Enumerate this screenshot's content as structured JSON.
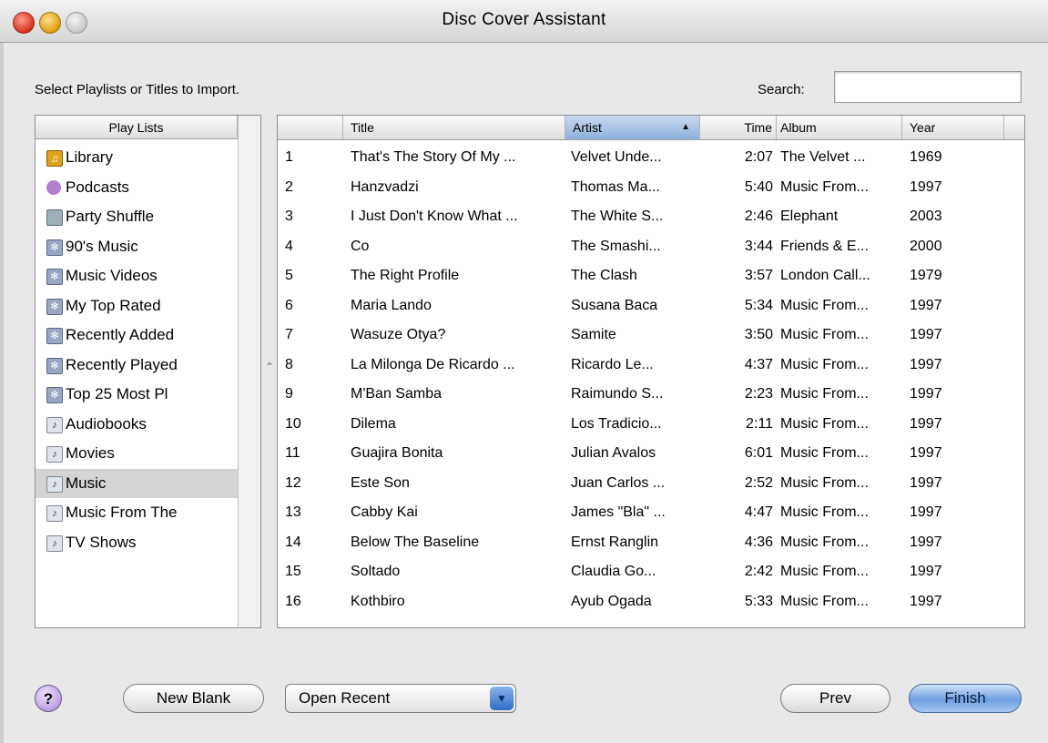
{
  "window": {
    "title": "Disc Cover Assistant"
  },
  "header": {
    "prompt": "Select Playlists or Titles to Import.",
    "search_label": "Search:",
    "search_value": ""
  },
  "playlists": {
    "header": "Play Lists",
    "items": [
      {
        "label": "Library",
        "icon": "library-icon",
        "selected": false
      },
      {
        "label": "Podcasts",
        "icon": "podcast-icon",
        "selected": false
      },
      {
        "label": "Party Shuffle",
        "icon": "party-shuffle-icon",
        "selected": false
      },
      {
        "label": "90's Music",
        "icon": "smart-playlist-icon",
        "selected": false
      },
      {
        "label": "Music Videos",
        "icon": "smart-playlist-icon",
        "selected": false
      },
      {
        "label": "My Top Rated",
        "icon": "smart-playlist-icon",
        "selected": false
      },
      {
        "label": "Recently Added",
        "icon": "smart-playlist-icon",
        "selected": false
      },
      {
        "label": "Recently Played",
        "icon": "smart-playlist-icon",
        "selected": false
      },
      {
        "label": "Top 25 Most Pl",
        "icon": "smart-playlist-icon",
        "selected": false
      },
      {
        "label": "Audiobooks",
        "icon": "playlist-icon",
        "selected": false
      },
      {
        "label": "Movies",
        "icon": "playlist-icon",
        "selected": false
      },
      {
        "label": "Music",
        "icon": "playlist-icon",
        "selected": true
      },
      {
        "label": "Music From The",
        "icon": "playlist-icon",
        "selected": false
      },
      {
        "label": "TV Shows",
        "icon": "playlist-icon",
        "selected": false
      }
    ]
  },
  "tracks": {
    "columns": {
      "title": "Title",
      "artist": "Artist",
      "time": "Time",
      "album": "Album",
      "year": "Year"
    },
    "sorted_by": "Artist",
    "sort_arrow": "▲",
    "rows": [
      {
        "num": "1",
        "title": "That's The Story Of My ...",
        "artist": "Velvet Unde...",
        "time": "2:07",
        "album": "The Velvet ...",
        "year": "1969"
      },
      {
        "num": "2",
        "title": "Hanzvadzi",
        "artist": "Thomas Ma...",
        "time": "5:40",
        "album": "Music From...",
        "year": "1997"
      },
      {
        "num": "3",
        "title": "I Just Don't Know What ...",
        "artist": "The White S...",
        "time": "2:46",
        "album": "Elephant",
        "year": "2003"
      },
      {
        "num": "4",
        "title": "Co",
        "artist": "The Smashi...",
        "time": "3:44",
        "album": "Friends & E...",
        "year": "2000"
      },
      {
        "num": "5",
        "title": "The Right Profile",
        "artist": "The Clash",
        "time": "3:57",
        "album": "London Call...",
        "year": "1979"
      },
      {
        "num": "6",
        "title": "Maria Lando",
        "artist": "Susana Baca",
        "time": "5:34",
        "album": "Music From...",
        "year": "1997"
      },
      {
        "num": "7",
        "title": "Wasuze Otya?",
        "artist": "Samite",
        "time": "3:50",
        "album": "Music From...",
        "year": "1997"
      },
      {
        "num": "8",
        "title": "La Milonga De Ricardo ...",
        "artist": "Ricardo Le...",
        "time": "4:37",
        "album": "Music From...",
        "year": "1997"
      },
      {
        "num": "9",
        "title": "M'Ban Samba",
        "artist": "Raimundo S...",
        "time": "2:23",
        "album": "Music From...",
        "year": "1997"
      },
      {
        "num": "10",
        "title": "Dilema",
        "artist": "Los Tradicio...",
        "time": "2:11",
        "album": "Music From...",
        "year": "1997"
      },
      {
        "num": "11",
        "title": "Guajira Bonita",
        "artist": "Julian Avalos",
        "time": "6:01",
        "album": "Music From...",
        "year": "1997"
      },
      {
        "num": "12",
        "title": "Este Son",
        "artist": "Juan Carlos ...",
        "time": "2:52",
        "album": "Music From...",
        "year": "1997"
      },
      {
        "num": "13",
        "title": "Cabby Kai",
        "artist": "James \"Bla\" ...",
        "time": "4:47",
        "album": "Music From...",
        "year": "1997"
      },
      {
        "num": "14",
        "title": "Below The Baseline",
        "artist": "Ernst Ranglin",
        "time": "4:36",
        "album": "Music From...",
        "year": "1997"
      },
      {
        "num": "15",
        "title": "Soltado",
        "artist": "Claudia Go...",
        "time": "2:42",
        "album": "Music From...",
        "year": "1997"
      },
      {
        "num": "16",
        "title": "Kothbiro",
        "artist": "Ayub Ogada",
        "time": "5:33",
        "album": "Music From...",
        "year": "1997"
      }
    ]
  },
  "footer": {
    "help_label": "?",
    "new_blank_label": "New Blank",
    "open_recent_label": "Open Recent",
    "prev_label": "Prev",
    "finish_label": "Finish"
  },
  "colors": {
    "selection": "#d4d4d4",
    "sorted_header": "#8fb0dc",
    "finish_button": "#6f9fe2"
  }
}
